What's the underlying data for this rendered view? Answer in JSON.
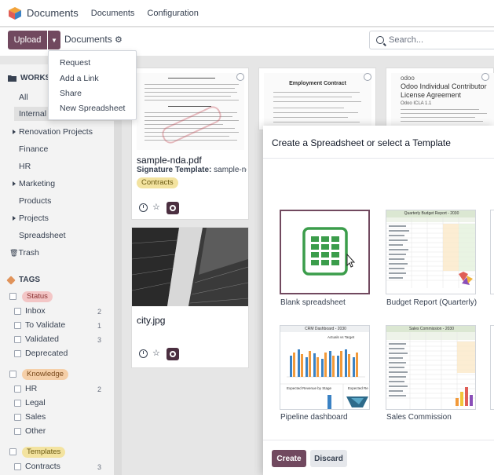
{
  "app": {
    "title": "Documents",
    "nav": [
      "Documents",
      "Configuration"
    ]
  },
  "control": {
    "upload_label": "Upload",
    "breadcrumb": "Documents",
    "search_placeholder": "Search..."
  },
  "dropdown": {
    "items": [
      "Request",
      "Add a Link",
      "Share",
      "New Spreadsheet"
    ]
  },
  "sidebar": {
    "workspace_header": "WORKS",
    "workspaces": [
      "All",
      "Internal",
      "Renovation Projects",
      "Finance",
      "HR",
      "Marketing",
      "Products",
      "Projects",
      "Spreadsheet"
    ],
    "trash": "Trash",
    "tags_header": "TAGS",
    "tag_groups": [
      {
        "name": "Status",
        "color": "#f3c6c6",
        "text_color": "#8a2f2f",
        "items": [
          {
            "label": "Inbox",
            "count": "2"
          },
          {
            "label": "To Validate",
            "count": "1"
          },
          {
            "label": "Validated",
            "count": "3"
          },
          {
            "label": "Deprecated",
            "count": ""
          }
        ]
      },
      {
        "name": "Knowledge",
        "color": "#f5cfa8",
        "text_color": "#7a4a1c",
        "items": [
          {
            "label": "HR",
            "count": "2"
          },
          {
            "label": "Legal",
            "count": ""
          },
          {
            "label": "Sales",
            "count": ""
          },
          {
            "label": "Other",
            "count": ""
          }
        ]
      },
      {
        "name": "Templates",
        "color": "#f3e3a0",
        "text_color": "#6b5a12",
        "items": [
          {
            "label": "Contracts",
            "count": "3"
          }
        ]
      }
    ]
  },
  "cards": {
    "nda": {
      "title": "sample-nda.pdf",
      "sig_label": "Signature Template:",
      "sig_value": "sample-nda...",
      "tag": "Contracts"
    },
    "city": {
      "title": "city.jpg"
    },
    "emp": {
      "heading": "Employment Contract"
    },
    "odoo": {
      "brand": "odoo",
      "heading": "Odoo Individual Contributor License Agreement",
      "sub": "Odoo ICLA 1.1"
    }
  },
  "modal": {
    "title": "Create a Spreadsheet or select a Template",
    "templates": [
      "Blank spreadsheet",
      "Budget Report (Quarterly)",
      "Pipeline dashboard",
      "Sales Commission"
    ],
    "preview_titles": [
      "Quarterly Budget Report - 2030",
      "CRM Dashboard - 2030",
      "Sales Commission - 2030"
    ],
    "preview_sub": [
      "Actuals vs Target",
      "Expected Revenue by Stage",
      "Expected Re"
    ],
    "create_label": "Create",
    "discard_label": "Discard"
  }
}
